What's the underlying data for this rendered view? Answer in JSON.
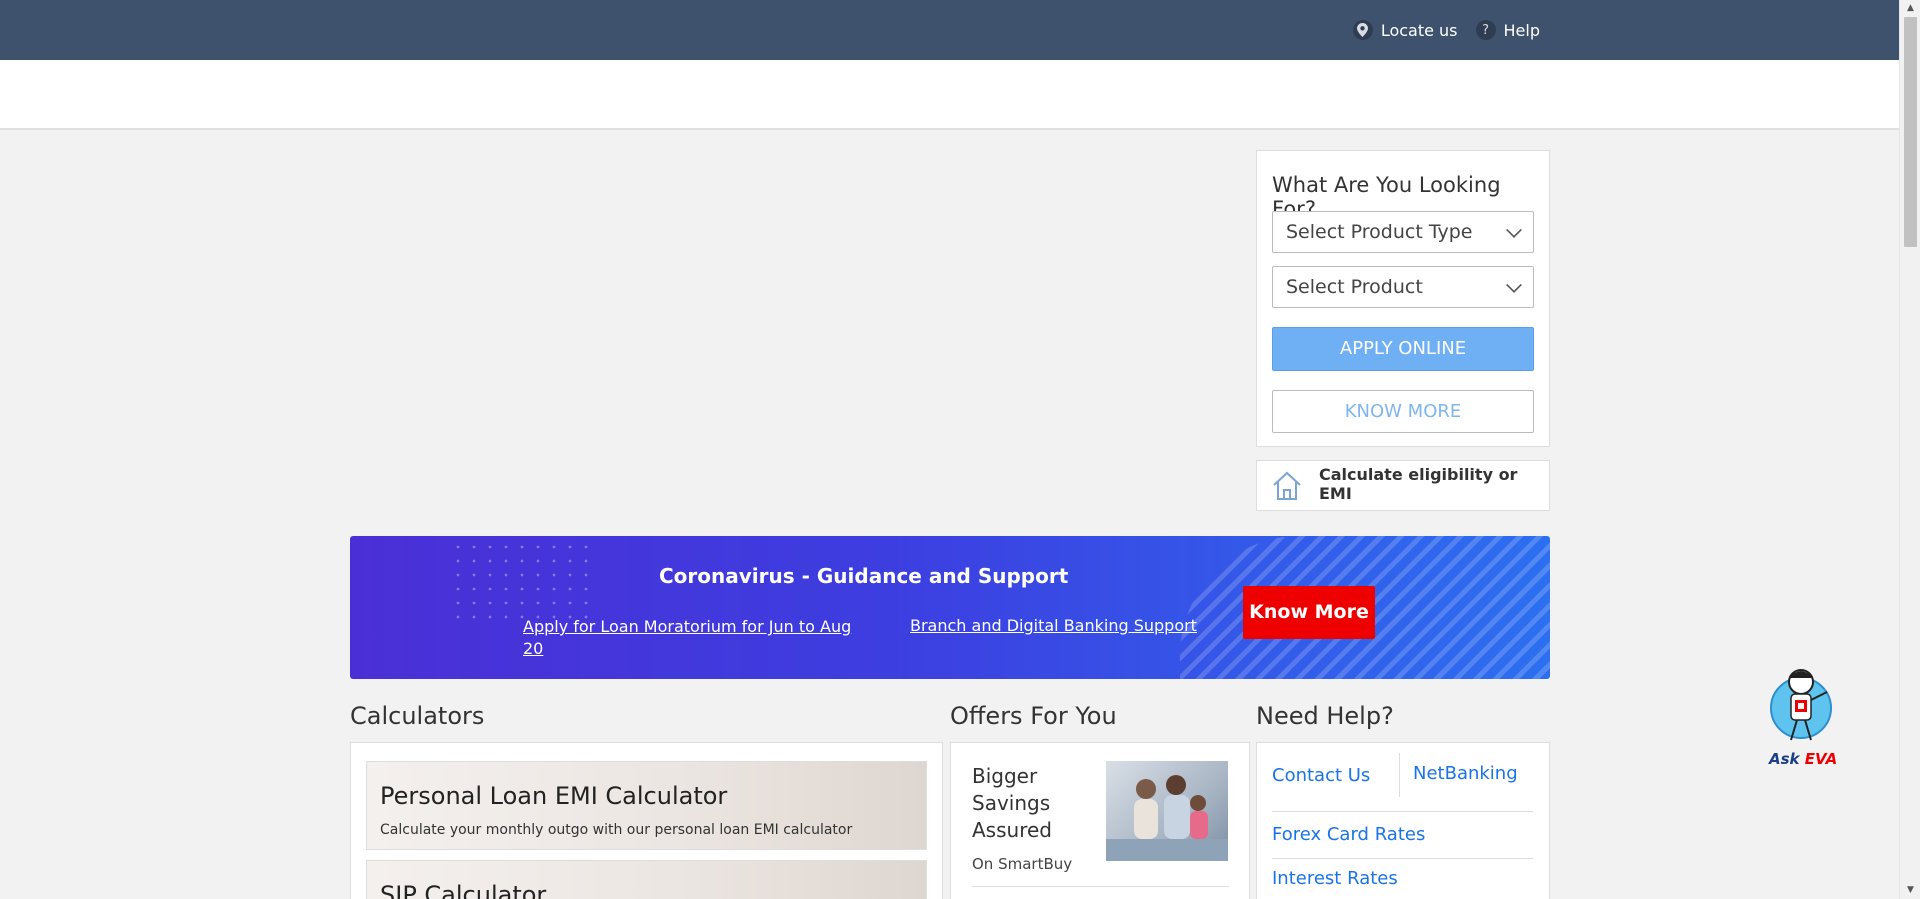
{
  "topbar": {
    "locate_label": "Locate us",
    "help_label": "Help"
  },
  "finder": {
    "heading": "What Are You Looking For?",
    "product_type_placeholder": "Select Product Type",
    "product_placeholder": "Select Product",
    "apply_label": "APPLY ONLINE",
    "know_more_label": "KNOW MORE"
  },
  "calc_eligibility": {
    "label": "Calculate eligibility or EMI"
  },
  "banner": {
    "title": "Coronavirus - Guidance and Support",
    "link1": "Apply for Loan Moratorium for Jun to Aug 20",
    "link2": "Branch and Digital Banking Support",
    "button": "Know More"
  },
  "sections": {
    "calculators": "Calculators",
    "offers": "Offers For You",
    "help": "Need Help?"
  },
  "calculators": [
    {
      "title": "Personal Loan EMI Calculator",
      "desc": "Calculate your monthly outgo with our personal loan EMI calculator"
    },
    {
      "title": "SIP Calculator",
      "desc": ""
    }
  ],
  "offer": {
    "title": "Bigger Savings Assured",
    "sub": "On SmartBuy"
  },
  "help_links": {
    "contact": "Contact Us",
    "netbanking": "NetBanking",
    "forex": "Forex Card Rates",
    "interest": "Interest Rates"
  },
  "eva": {
    "ask": "Ask ",
    "name": "EVA"
  },
  "colors": {
    "topbar": "#3e526e",
    "apply_button": "#6fb0f5",
    "know_more_red": "#ee0000",
    "link_blue": "#1a73e8"
  }
}
